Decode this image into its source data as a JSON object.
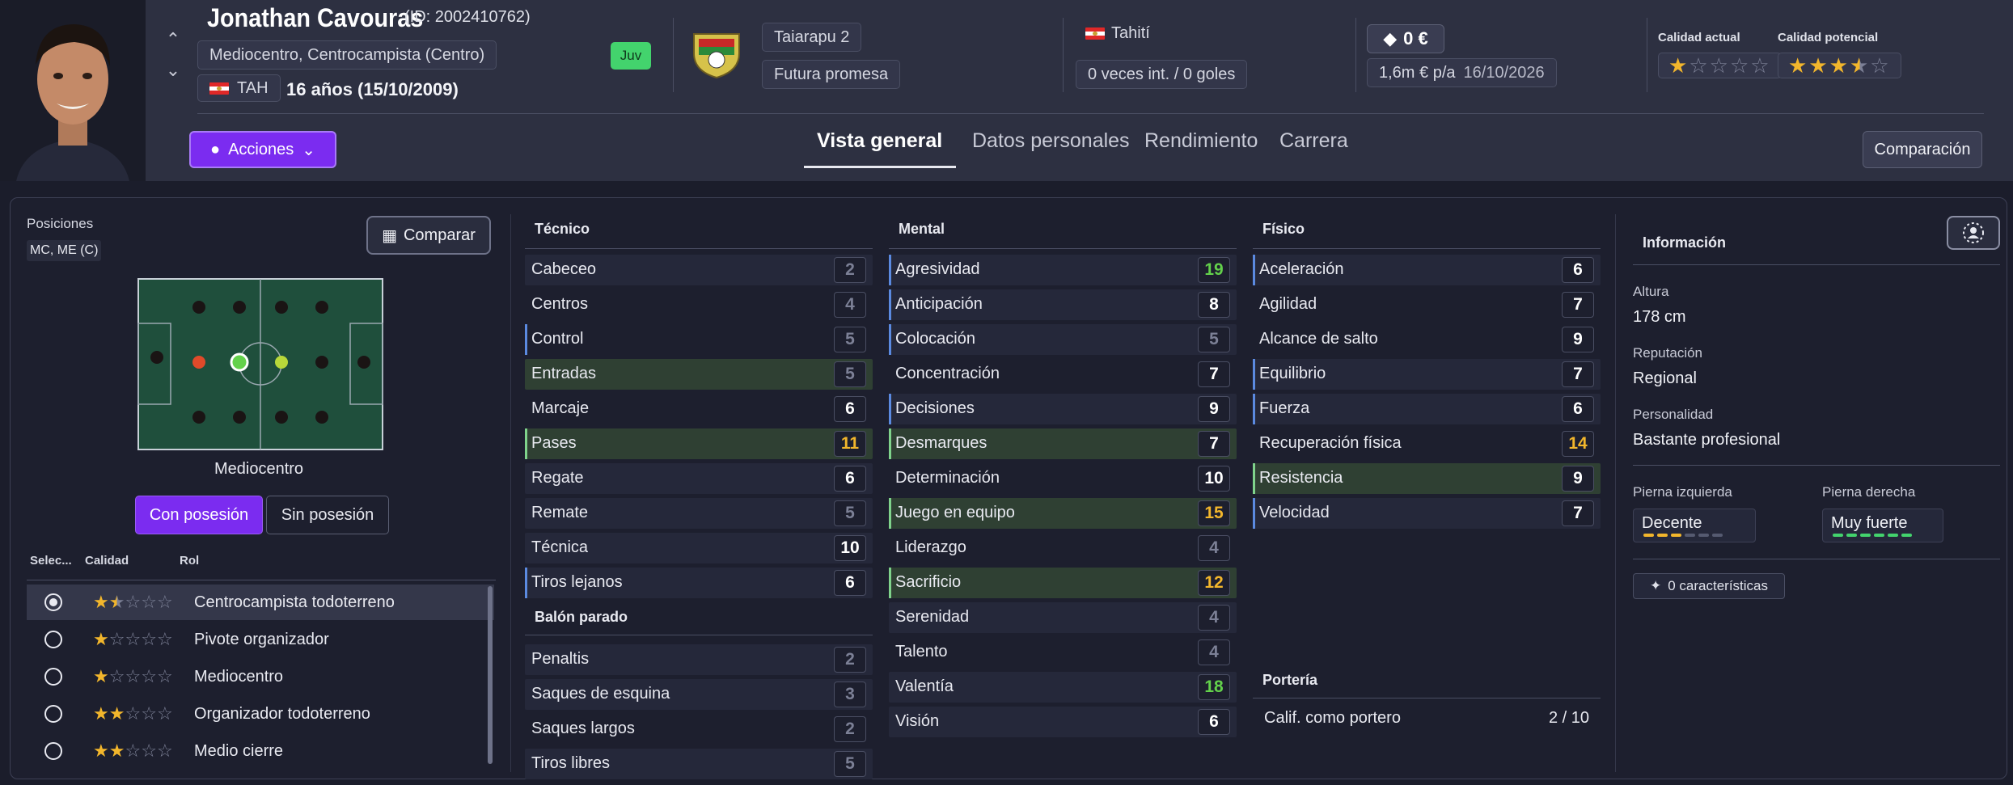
{
  "player": {
    "name": "Jonathan Cavouras",
    "id": "(ID: 2002410762)",
    "positions": "Mediocentro, Centrocampista (Centro)",
    "nationality_code": "TAH",
    "age": "16 años (15/10/2009)",
    "youth_badge": "Juv"
  },
  "club": {
    "name": "Taiarapu 2",
    "status": "Futura promesa"
  },
  "international": {
    "country": "Tahití",
    "caps": "0 veces int. / 0 goles"
  },
  "contract": {
    "value": "0 €",
    "wage": "1,6m € p/a",
    "expiry": "16/10/2026"
  },
  "quality": {
    "current_label": "Calidad actual",
    "current_stars": 1,
    "potential_label": "Calidad potencial",
    "potential_stars": 3.5,
    "max_stars": 5
  },
  "actions_label": "Acciones",
  "tabs": [
    {
      "label": "Vista general",
      "active": true
    },
    {
      "label": "Datos personales",
      "active": false
    },
    {
      "label": "Rendimiento",
      "active": false
    },
    {
      "label": "Carrera",
      "active": false
    }
  ],
  "comparison_label": "Comparación",
  "positions_panel": {
    "title": "Posiciones",
    "value": "MC, ME (C)",
    "compare_label": "Comparar",
    "pitch_label": "Mediocentro",
    "with_possession": "Con posesión",
    "without_possession": "Sin posesión"
  },
  "roles": {
    "headers": [
      "Selec...",
      "Calidad",
      "Rol"
    ],
    "items": [
      {
        "name": "Centrocampista todoterreno",
        "stars": 1.5,
        "selected": true
      },
      {
        "name": "Pivote organizador",
        "stars": 1,
        "selected": false
      },
      {
        "name": "Mediocentro",
        "stars": 1,
        "selected": false
      },
      {
        "name": "Organizador todoterreno",
        "stars": 2,
        "selected": false
      },
      {
        "name": "Medio cierre",
        "stars": 2,
        "selected": false
      }
    ]
  },
  "technical": {
    "title": "Técnico",
    "attributes": [
      {
        "name": "Cabeceo",
        "value": 2
      },
      {
        "name": "Centros",
        "value": 4
      },
      {
        "name": "Control",
        "value": 5
      },
      {
        "name": "Entradas",
        "value": 5
      },
      {
        "name": "Marcaje",
        "value": 6
      },
      {
        "name": "Pases",
        "value": 11
      },
      {
        "name": "Regate",
        "value": 6
      },
      {
        "name": "Remate",
        "value": 5
      },
      {
        "name": "Técnica",
        "value": 10
      },
      {
        "name": "Tiros lejanos",
        "value": 6
      }
    ]
  },
  "set_pieces": {
    "title": "Balón parado",
    "attributes": [
      {
        "name": "Penaltis",
        "value": 2
      },
      {
        "name": "Saques de esquina",
        "value": 3
      },
      {
        "name": "Saques largos",
        "value": 2
      },
      {
        "name": "Tiros libres",
        "value": 5
      }
    ]
  },
  "mental": {
    "title": "Mental",
    "attributes": [
      {
        "name": "Agresividad",
        "value": 19
      },
      {
        "name": "Anticipación",
        "value": 8
      },
      {
        "name": "Colocación",
        "value": 5
      },
      {
        "name": "Concentración",
        "value": 7
      },
      {
        "name": "Decisiones",
        "value": 9
      },
      {
        "name": "Desmarques",
        "value": 7
      },
      {
        "name": "Determinación",
        "value": 10
      },
      {
        "name": "Juego en equipo",
        "value": 15
      },
      {
        "name": "Liderazgo",
        "value": 4
      },
      {
        "name": "Sacrificio",
        "value": 12
      },
      {
        "name": "Serenidad",
        "value": 4
      },
      {
        "name": "Talento",
        "value": 4
      },
      {
        "name": "Valentía",
        "value": 18
      },
      {
        "name": "Visión",
        "value": 6
      }
    ]
  },
  "physical": {
    "title": "Físico",
    "attributes": [
      {
        "name": "Aceleración",
        "value": 6
      },
      {
        "name": "Agilidad",
        "value": 7
      },
      {
        "name": "Alcance de salto",
        "value": 9
      },
      {
        "name": "Equilibrio",
        "value": 7
      },
      {
        "name": "Fuerza",
        "value": 6
      },
      {
        "name": "Recuperación física",
        "value": 14
      },
      {
        "name": "Resistencia",
        "value": 9
      },
      {
        "name": "Velocidad",
        "value": 7
      }
    ]
  },
  "goalkeeping": {
    "title": "Portería",
    "label": "Calif. como portero",
    "value": "2 / 10"
  },
  "info": {
    "title": "Información",
    "height_label": "Altura",
    "height": "178 cm",
    "reputation_label": "Reputación",
    "reputation": "Regional",
    "personality_label": "Personalidad",
    "personality": "Bastante profesional",
    "left_foot_label": "Pierna izquierda",
    "left_foot": "Decente",
    "left_foot_level": 3,
    "right_foot_label": "Pierna derecha",
    "right_foot": "Muy fuerte",
    "right_foot_level": 6,
    "foot_max": 6,
    "characteristics": "0 características"
  },
  "colors": {
    "accent": "#7b2cf0",
    "star": "#f2b62c",
    "great": "#63d14b",
    "good": "#f2b62c",
    "low": "#7c8096"
  }
}
